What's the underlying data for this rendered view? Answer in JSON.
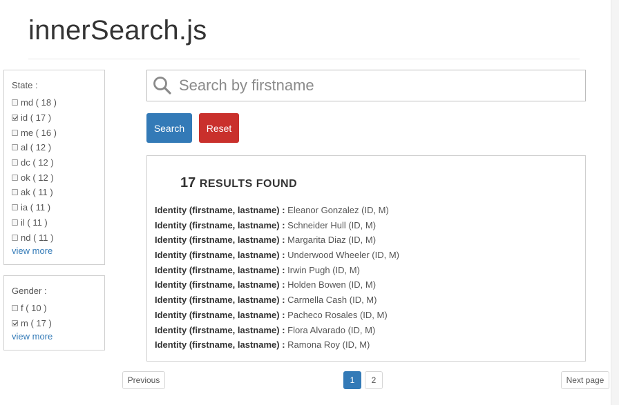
{
  "header": {
    "title": "innerSearch.js"
  },
  "facets": {
    "state": {
      "title": "State :",
      "options": [
        {
          "label": "md ( 18 )",
          "checked": false
        },
        {
          "label": "id ( 17 )",
          "checked": true
        },
        {
          "label": "me ( 16 )",
          "checked": false
        },
        {
          "label": "al ( 12 )",
          "checked": false
        },
        {
          "label": "dc ( 12 )",
          "checked": false
        },
        {
          "label": "ok ( 12 )",
          "checked": false
        },
        {
          "label": "ak ( 11 )",
          "checked": false
        },
        {
          "label": "ia ( 11 )",
          "checked": false
        },
        {
          "label": "il ( 11 )",
          "checked": false
        },
        {
          "label": "nd ( 11 )",
          "checked": false
        }
      ],
      "view_more": "view more"
    },
    "gender": {
      "title": "Gender :",
      "options": [
        {
          "label": "f ( 10 )",
          "checked": false
        },
        {
          "label": "m ( 17 )",
          "checked": true
        }
      ],
      "view_more": "view more"
    }
  },
  "search": {
    "placeholder": "Search by firstname",
    "value": "",
    "icon": "search-icon",
    "search_label": "Search",
    "reset_label": "Reset"
  },
  "results": {
    "count": "17",
    "count_label": "RESULTS FOUND",
    "key_label": "Identity (firstname, lastname) :",
    "items": [
      "Eleanor Gonzalez (ID, M)",
      "Schneider Hull (ID, M)",
      "Margarita Diaz (ID, M)",
      "Underwood Wheeler (ID, M)",
      "Irwin Pugh (ID, M)",
      "Holden Bowen (ID, M)",
      "Carmella Cash (ID, M)",
      "Pacheco Rosales (ID, M)",
      "Flora Alvarado (ID, M)",
      "Ramona Roy (ID, M)"
    ]
  },
  "pagination": {
    "previous_label": "Previous",
    "next_label": "Next page",
    "pages": [
      "1",
      "2"
    ],
    "current": "1"
  },
  "colors": {
    "primary": "#337ab7",
    "danger": "#c9302c",
    "link": "#337ab7"
  }
}
